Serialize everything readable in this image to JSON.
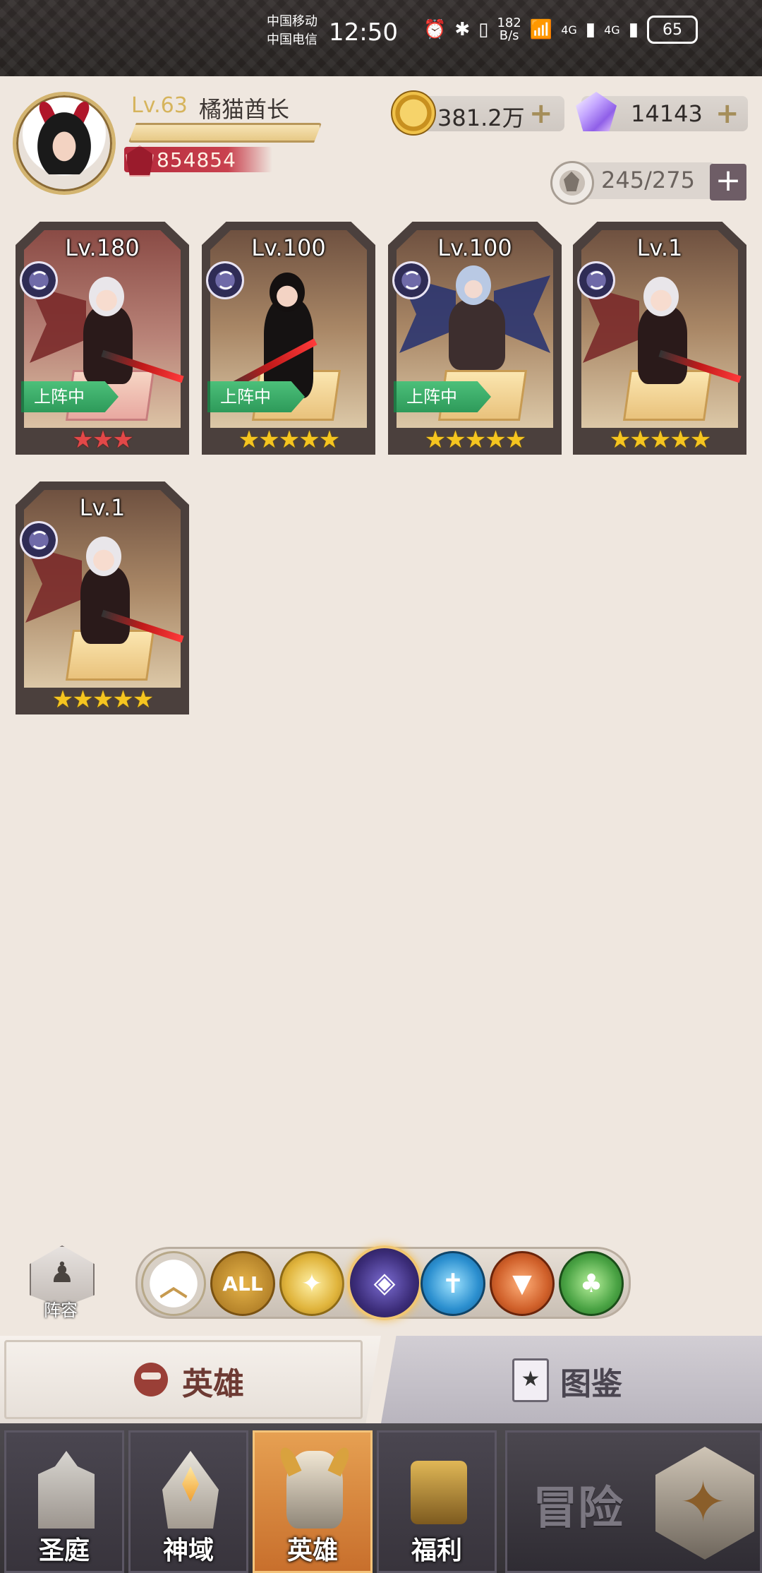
{
  "status_bar": {
    "carrier1": "中国移动",
    "carrier2": "中国电信",
    "time": "12:50",
    "net_speed_value": "182",
    "net_speed_unit": "B/s",
    "signal1": "4G",
    "signal2": "4G",
    "battery": "65"
  },
  "player": {
    "level": "Lv.63",
    "name": "橘猫酋长",
    "power": "854854"
  },
  "resources": {
    "gold": "381.2万",
    "gems": "14143",
    "stamina": "245/275"
  },
  "heroes": [
    {
      "level": "Lv.180",
      "stars": "★★★",
      "star_color": "red",
      "on_team": true,
      "on_team_label": "上阵中"
    },
    {
      "level": "Lv.100",
      "stars": "★★★★★",
      "star_color": "gold",
      "on_team": true,
      "on_team_label": "上阵中"
    },
    {
      "level": "Lv.100",
      "stars": "★★★★★",
      "star_color": "gold",
      "on_team": true,
      "on_team_label": "上阵中"
    },
    {
      "level": "Lv.1",
      "stars": "★★★★★",
      "star_color": "gold",
      "on_team": false
    },
    {
      "level": "Lv.1",
      "stars": "★★★★★",
      "star_color": "gold",
      "on_team": false
    }
  ],
  "filter": {
    "lineup_label": "阵容",
    "all_label": "ALL",
    "selected": "dark"
  },
  "subtabs": {
    "hero": "英雄",
    "guide": "图鉴"
  },
  "bottom_nav": {
    "court": "圣庭",
    "domain": "神域",
    "hero": "英雄",
    "welfare": "福利",
    "adventure": "冒险"
  }
}
